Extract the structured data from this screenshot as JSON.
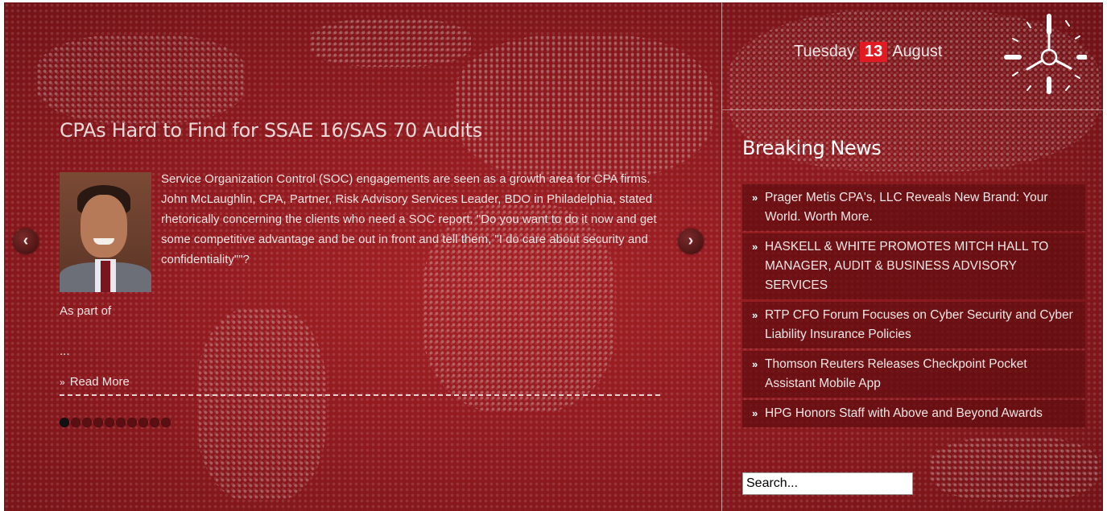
{
  "feature": {
    "headline": "CPAs Hard to Find for SSAE 16/SAS 70 Audits",
    "summary": "Service Organization Control (SOC) engagements are seen as a growth area for CPA firms. John McLaughlin, CPA, Partner, Risk Advisory Services Leader, BDO in Philadelphia, stated rhetorically concerning the clients who need a SOC report, \"Do you want to do it now and get some competitive advantage and be out in front and tell them, \"I do care about security and confidentiality\"\"?",
    "continuation": "As part of",
    "ellipsis": "...",
    "read_more_prefix": "»",
    "read_more": "Read More",
    "slide_count": 10,
    "active_slide": 1,
    "prev_icon": "‹",
    "next_icon": "›"
  },
  "date": {
    "weekday": "Tuesday",
    "day": "13",
    "month": "August"
  },
  "breaking_news": {
    "title": "Breaking News",
    "bullet": "»",
    "items": [
      "Prager Metis CPA's, LLC Reveals New Brand: Your World. Worth More.",
      "HASKELL & WHITE PROMOTES MITCH HALL TO MANAGER, AUDIT & BUSINESS ADVISORY SERVICES",
      "RTP CFO Forum Focuses on Cyber Security and Cyber Liability Insurance Policies",
      "Thomson Reuters Releases Checkpoint Pocket Assistant Mobile App",
      "HPG Honors Staff with Above and Beyond Awards"
    ]
  },
  "search": {
    "placeholder": "Search..."
  },
  "colors": {
    "background": "#8e1a1f",
    "accent": "#e21b23"
  }
}
